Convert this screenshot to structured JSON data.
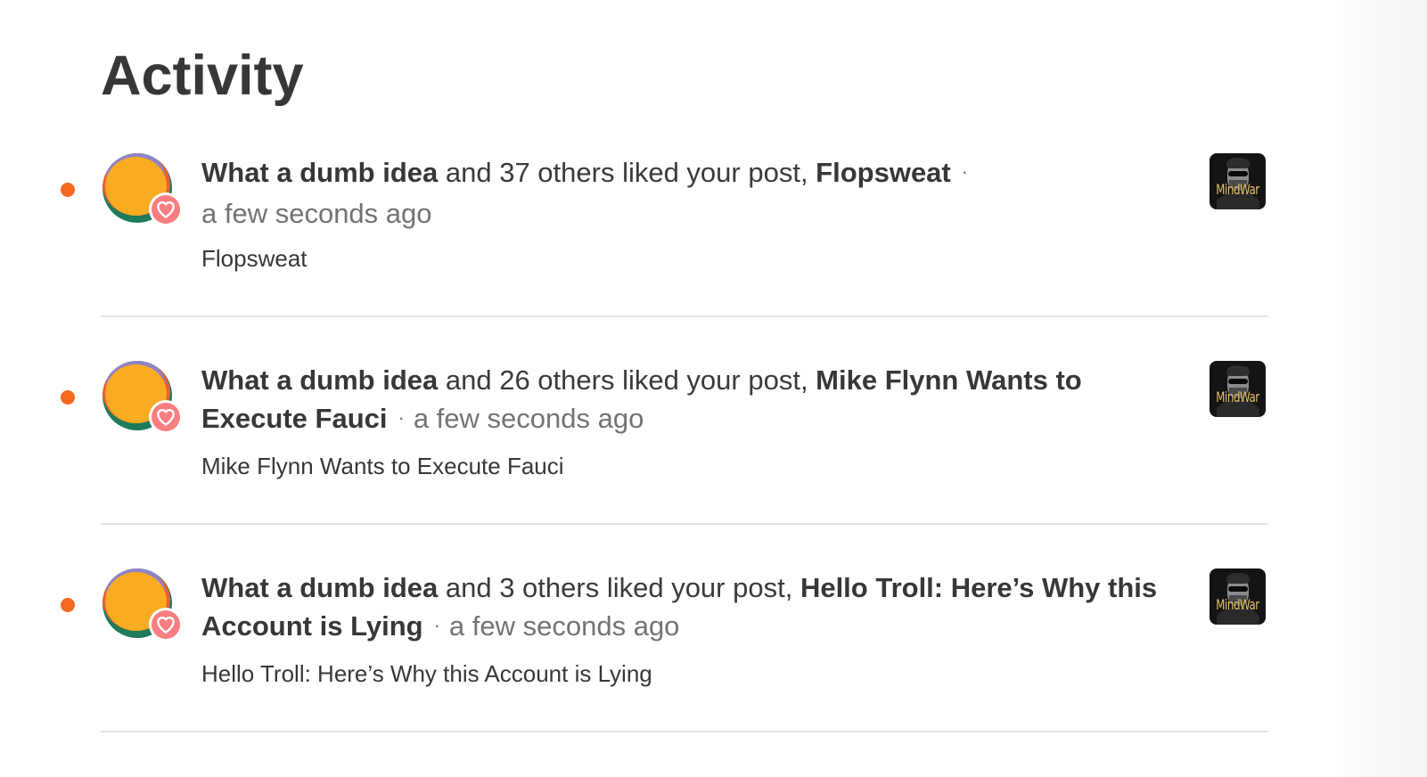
{
  "page": {
    "title": "Activity"
  },
  "activity": {
    "items": [
      {
        "unread": true,
        "avatar_icon": "user-avatar-icon",
        "badge_icon": "heart-icon",
        "actor": "What a dumb idea",
        "action": " and 37 others liked your post, ",
        "post_title": "Flopsweat",
        "separator": "·",
        "time": "a few seconds ago",
        "excerpt": "Flopsweat",
        "thumbnail_text": "MindWar"
      },
      {
        "unread": true,
        "avatar_icon": "user-avatar-icon",
        "badge_icon": "heart-icon",
        "actor": "What a dumb idea",
        "action": " and 26 others liked your post, ",
        "post_title": "Mike Flynn Wants to Execute Fauci",
        "separator": "·",
        "time": "a few seconds ago",
        "excerpt": "Mike Flynn Wants to Execute Fauci",
        "thumbnail_text": "MindWar"
      },
      {
        "unread": true,
        "avatar_icon": "user-avatar-icon",
        "badge_icon": "heart-icon",
        "actor": "What a dumb idea",
        "action": " and 3 others liked your post, ",
        "post_title": "Hello Troll: Here’s Why this Account is Lying",
        "separator": "·",
        "time": "a few seconds ago",
        "excerpt": "Hello Troll: Here’s Why this Account is Lying",
        "thumbnail_text": "MindWar"
      }
    ]
  },
  "colors": {
    "unread_dot": "#f5691f",
    "heart_badge": "#fa7d81",
    "title_text": "#363737",
    "time_text": "#737373",
    "divider": "#e3e3e3"
  }
}
